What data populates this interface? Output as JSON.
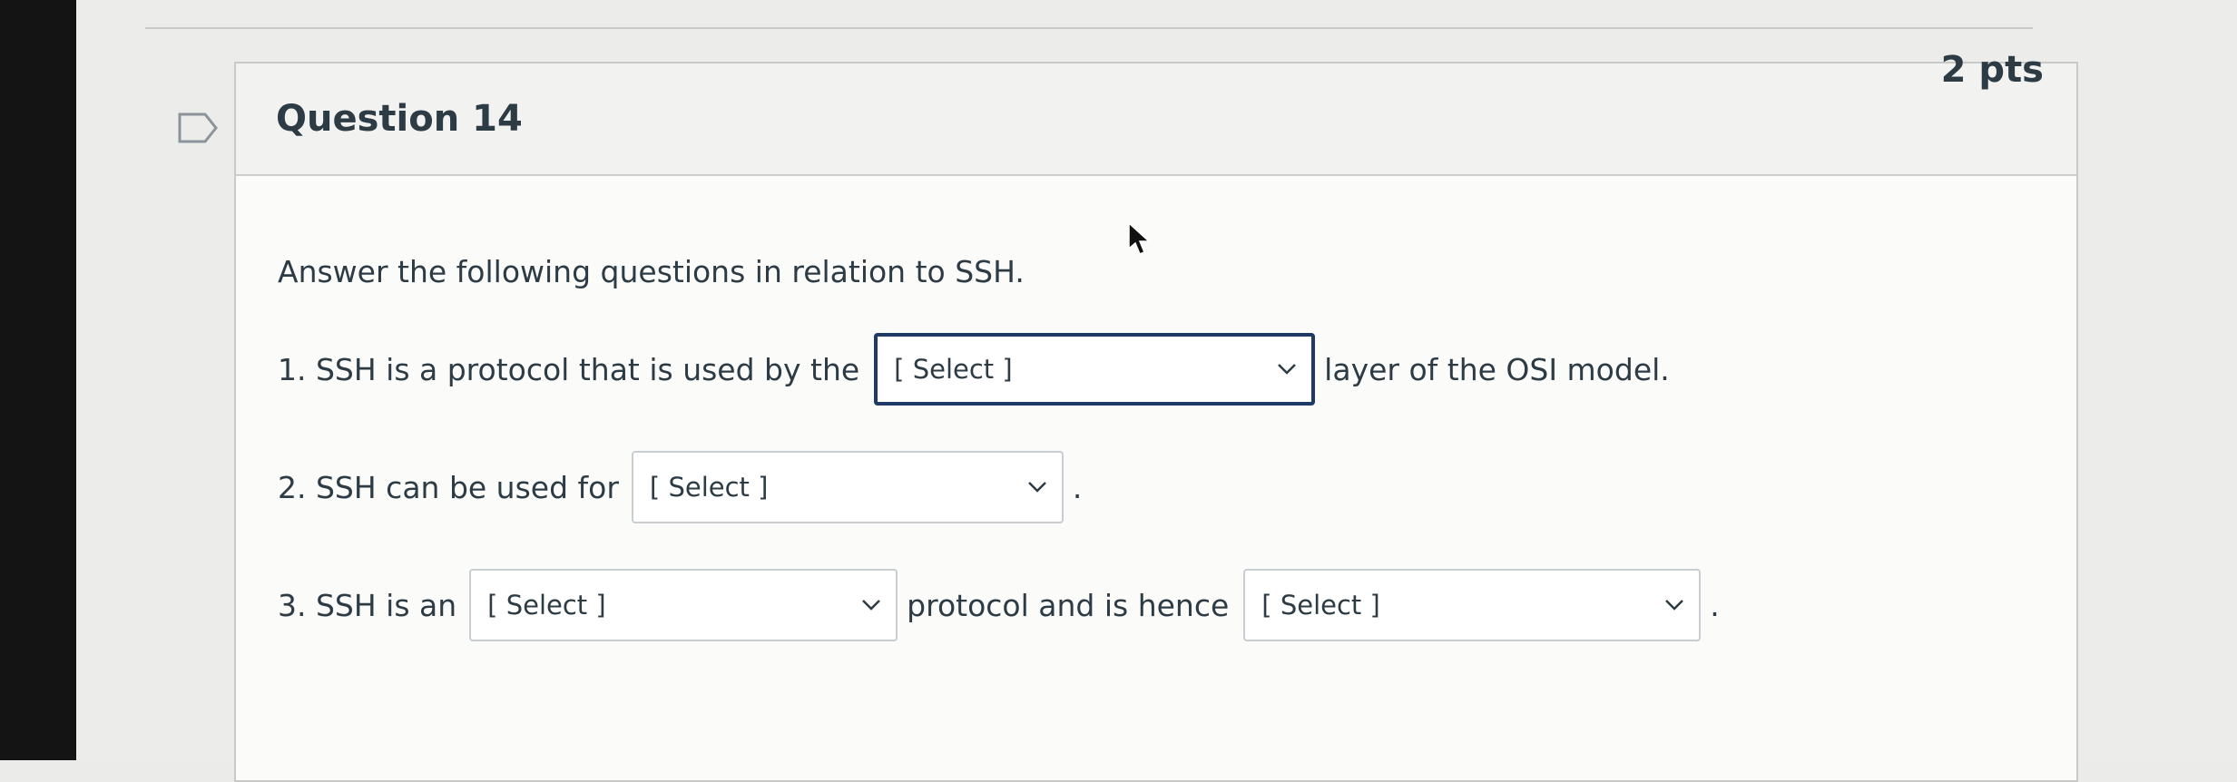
{
  "question": {
    "title": "Question 14",
    "points": "2 pts",
    "instruction": "Answer the following questions in relation to SSH."
  },
  "items": [
    {
      "prefix": "1. SSH is a protocol that is used by the",
      "select_value": "[ Select ]",
      "suffix": "layer of the OSI model."
    },
    {
      "prefix": "2. SSH can be used for",
      "select_value": "[ Select ]",
      "suffix": "."
    },
    {
      "prefix": "3. SSH is an",
      "select_value": "[ Select ]",
      "middle": "protocol and is hence",
      "select2_value": "[ Select ]",
      "suffix": "."
    }
  ],
  "colors": {
    "focus_border": "#1f3a66",
    "text": "#2d3b45",
    "card_header": "#f2f2f1"
  },
  "icons": {
    "bookmark": "flag-outline-icon",
    "dropdown": "chevron-down-icon",
    "cursor": "mouse-pointer-icon"
  }
}
